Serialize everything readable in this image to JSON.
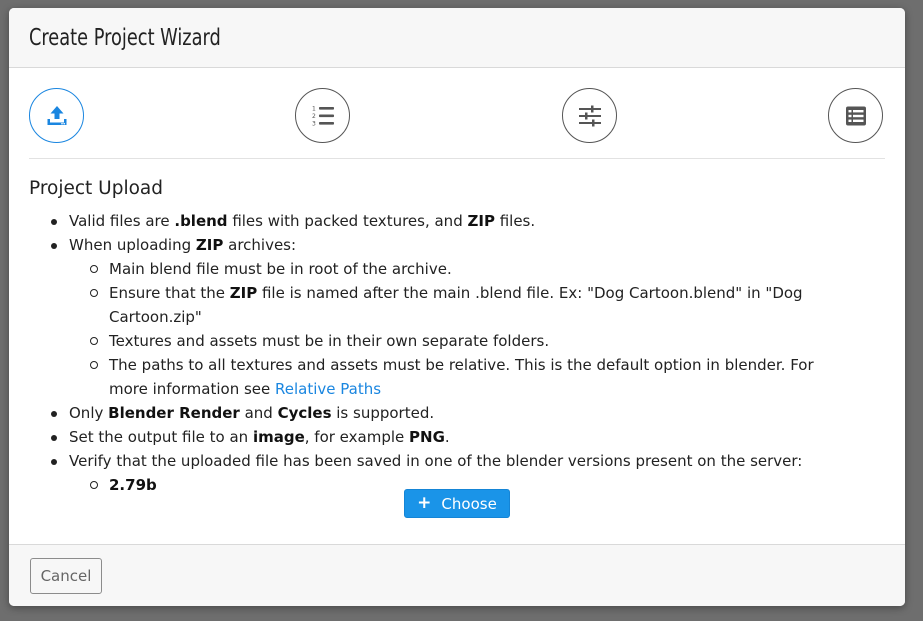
{
  "dialog": {
    "title": "Create Project Wizard"
  },
  "steps": [
    {
      "icon": "upload-icon",
      "active": true
    },
    {
      "icon": "numbered-list-icon",
      "active": false
    },
    {
      "icon": "sliders-icon",
      "active": false
    },
    {
      "icon": "list-box-icon",
      "active": false
    }
  ],
  "upload": {
    "heading": "Project Upload",
    "item1": {
      "t1": "Valid files are ",
      "b1": ".blend",
      "t2": " files with packed textures, and ",
      "b2": "ZIP",
      "t3": " files."
    },
    "item2": {
      "t1": "When uploading ",
      "b1": "ZIP",
      "t2": " archives:"
    },
    "sub2_1": "Main blend file must be in root of the archive.",
    "sub2_2": {
      "t1": "Ensure that the ",
      "b1": "ZIP",
      "t2": " file is named after the main .blend file. Ex: \"Dog Cartoon.blend\" in \"Dog Cartoon.zip\""
    },
    "sub2_3": "Textures and assets must be in their own separate folders.",
    "sub2_4": {
      "t1": "The paths to all textures and assets must be relative. This is the default option in blender. For more information see ",
      "link": "Relative Paths"
    },
    "item3": {
      "t1": "Only ",
      "b1": "Blender Render",
      "t2": " and ",
      "b2": "Cycles",
      "t3": " is supported."
    },
    "item4": {
      "t1": "Set the output file to an ",
      "b1": "image",
      "t2": ", for example ",
      "b2": "PNG",
      "t3": "."
    },
    "item5": "Verify that the uploaded file has been saved in one of the blender versions present on the server:",
    "versions": [
      "2.79b"
    ]
  },
  "buttons": {
    "choose_plus": "+",
    "choose": "Choose",
    "cancel": "Cancel"
  },
  "colors": {
    "accent": "#1a94e8",
    "link": "#1a86e0",
    "overlay": "#6e6e6e"
  }
}
